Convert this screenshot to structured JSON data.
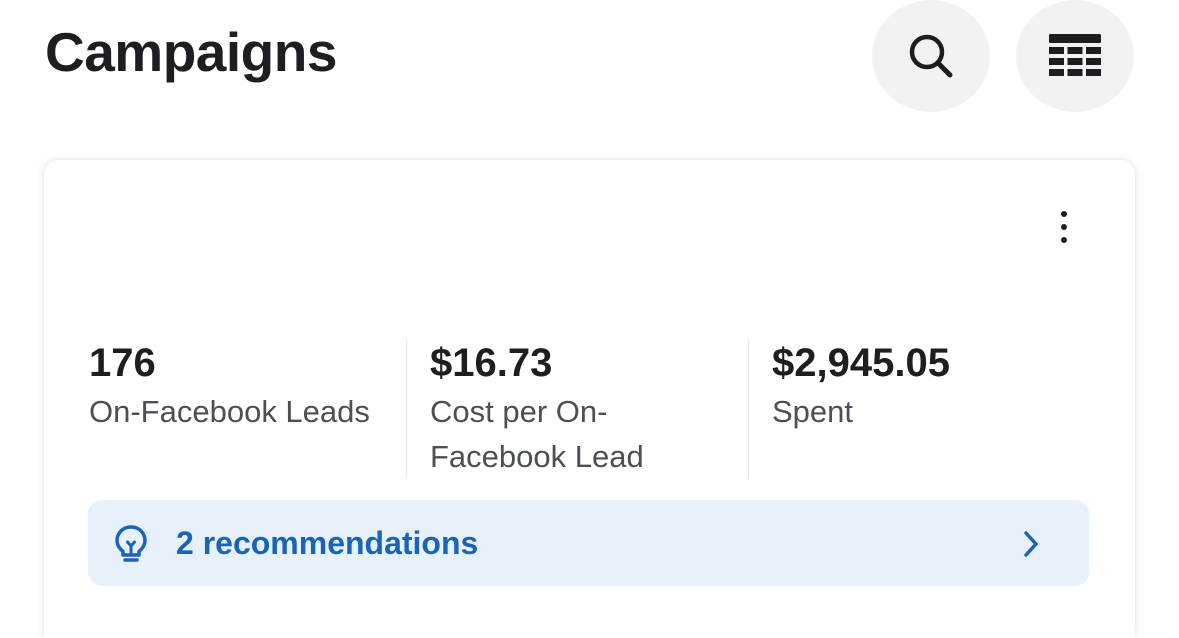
{
  "header": {
    "title": "Campaigns",
    "search_icon": "search-icon",
    "table_icon": "table-view-icon"
  },
  "card": {
    "more_icon": "more-vertical-icon",
    "metrics": [
      {
        "value": "176",
        "label": "On-Facebook Leads"
      },
      {
        "value": "$16.73",
        "label": "Cost per On-Facebook Lead"
      },
      {
        "value": "$2,945.05",
        "label": "Spent"
      }
    ],
    "recommendations": {
      "label": "2 recommendations",
      "icon": "lightbulb-icon",
      "chevron": "chevron-right-icon",
      "accent_color": "#1b63b8",
      "background_color": "#e7f1fb"
    }
  }
}
